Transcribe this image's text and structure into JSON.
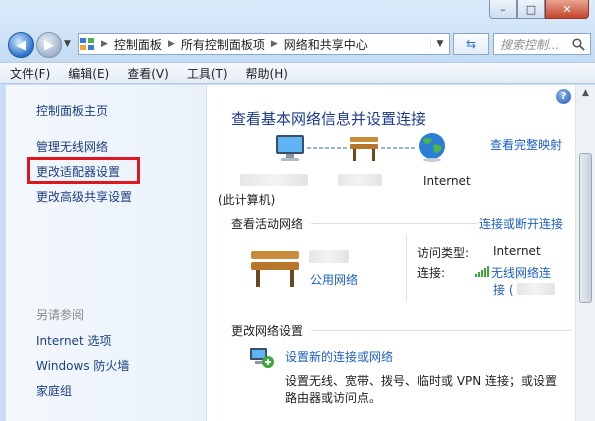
{
  "window": {
    "address": {
      "crumbs": [
        "控制面板",
        "所有控制面板项",
        "网络和共享中心"
      ]
    },
    "search_placeholder": "搜索控制...",
    "caption_buttons": {
      "minimize": "–",
      "maximize": "□",
      "close": "✕"
    }
  },
  "menu": [
    "文件(F)",
    "编辑(E)",
    "查看(V)",
    "工具(T)",
    "帮助(H)"
  ],
  "left_pane": {
    "home": "控制面板主页",
    "links": [
      "管理无线网络",
      "更改适配器设置",
      "更改高级共享设置"
    ],
    "see_also_title": "另请参阅",
    "see_also": [
      "Internet 选项",
      "Windows 防火墙",
      "家庭组"
    ]
  },
  "main": {
    "help": "?",
    "title": "查看基本网络信息并设置连接",
    "full_map_link": "查看完整映射",
    "map": {
      "computer_label": "(此计算机)",
      "internet_label": "Internet"
    },
    "active_network": {
      "header": "查看活动网络",
      "connect_link": "连接或断开连接",
      "network_type": "公用网络",
      "access_type_label": "访问类型:",
      "access_type_value": "Internet",
      "connection_label": "连接:",
      "connection_value_1": "无线网络连",
      "connection_value_2": "接 ("
    },
    "change_settings": {
      "header": "更改网络设置",
      "new_connection_link": "设置新的连接或网络",
      "new_connection_desc_1": "设置无线、宽带、拨号、临时或 VPN 连接；或设置",
      "new_connection_desc_2": "路由器或访问点。"
    }
  },
  "colors": {
    "link": "#1e5fc4",
    "title": "#1c3b8c",
    "highlight_box": "#e0161e",
    "left_pane_bg": "#eef4fb"
  }
}
